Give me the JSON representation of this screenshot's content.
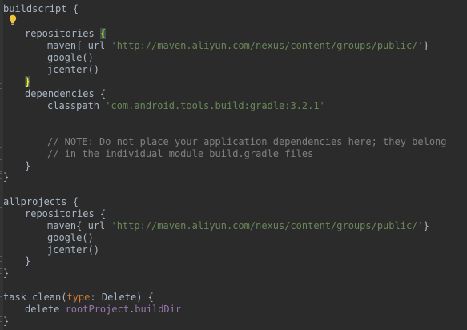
{
  "editor": {
    "language": "gradle",
    "colors": {
      "background": "#2b2b2b",
      "text": "#a9b7c6",
      "string": "#6a8759",
      "comment": "#808080",
      "keyword": "#cc7832",
      "property": "#9876aa",
      "brace_highlight": "#ffef28"
    },
    "lines": {
      "l1": "buildscript {",
      "l3_a": "repositories ",
      "l3_b": "{",
      "l4_a": "maven{ url ",
      "l4_b": "'http://maven.aliyun.com/nexus/content/groups/public/'",
      "l4_c": "}",
      "l5": "google()",
      "l6": "jcenter()",
      "l7": "}",
      "l8": "dependencies {",
      "l9_a": "classpath ",
      "l9_b": "'com.android.tools.build:gradle:3.2.1'",
      "l12": "// NOTE: Do not place your application dependencies here; they belong",
      "l13": "// in the individual module build.gradle files",
      "l14": "}",
      "l15": "}",
      "l17": "allprojects {",
      "l18": "repositories {",
      "l19_a": "maven{ url ",
      "l19_b": "'http://maven.aliyun.com/nexus/content/groups/public/'",
      "l19_c": "}",
      "l20": "google()",
      "l21": "jcenter()",
      "l22": "}",
      "l23": "}",
      "l25_a": "task clean(",
      "l25_b": "type",
      "l25_c": ": Delete) {",
      "l26_a": "delete ",
      "l26_b": "rootProject",
      "l26_c": ".",
      "l26_d": "buildDir",
      "l27": "}"
    }
  }
}
